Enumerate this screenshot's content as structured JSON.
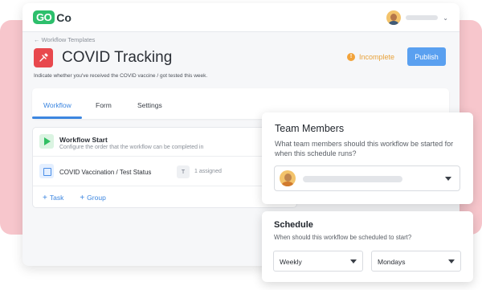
{
  "header": {
    "logo_go": "GO",
    "logo_co": "Co",
    "user_menu_icon": "chevron-down-icon"
  },
  "breadcrumb": "← Workflow Templates",
  "page": {
    "title": "COVID Tracking",
    "title_icon": "syringe-icon",
    "description": "Indicate whether you've received the COVID vaccine / got tested this week.",
    "status": "Incomplete",
    "status_icon": "exclamation-circle-icon",
    "publish_label": "Publish"
  },
  "tabs": [
    {
      "label": "Workflow",
      "active": true
    },
    {
      "label": "Form",
      "active": false
    },
    {
      "label": "Settings",
      "active": false
    }
  ],
  "workflow": {
    "start_title": "Workflow Start",
    "start_subtitle": "Configure the order that the workflow can be completed in",
    "step_label": "COVID Vaccination / Test Status",
    "step_badge": "T",
    "step_assigned": "1 assigned",
    "add_task": "Task",
    "add_group": "Group"
  },
  "team_members": {
    "title": "Team Members",
    "question": "What team members should this workflow be started for when this schedule runs?"
  },
  "schedule": {
    "title": "Schedule",
    "question": "When should this workflow be scheduled to start?",
    "frequency": "Weekly",
    "day": "Mondays"
  },
  "colors": {
    "accent": "#3c86e0",
    "publish": "#5aa0f0",
    "warning": "#f2a33a",
    "brand_green": "#2dbf6c",
    "title_icon_bg": "#e8484d",
    "backdrop": "#f7c6cc"
  }
}
